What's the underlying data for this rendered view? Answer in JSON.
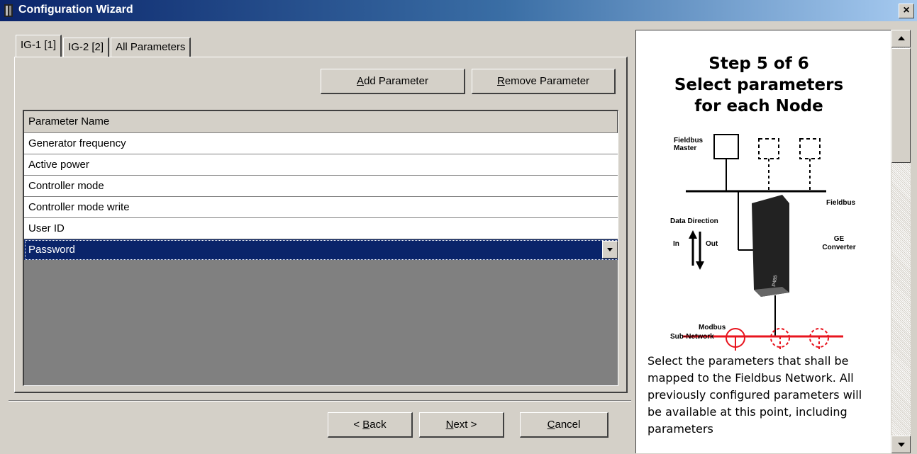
{
  "window": {
    "title": "Configuration Wizard",
    "close_glyph": "×"
  },
  "tabs": [
    {
      "label": "IG-1 [1]",
      "active": true
    },
    {
      "label": "IG-2 [2]",
      "active": false
    },
    {
      "label": "All Parameters",
      "active": false
    }
  ],
  "toolbar": {
    "add_label_accel": "A",
    "add_label_rest": "dd Parameter",
    "remove_label_accel": "R",
    "remove_label_rest": "emove Parameter"
  },
  "grid": {
    "header": "Parameter Name",
    "rows": [
      "Generator frequency",
      "Active power",
      "Controller mode",
      "Controller mode write",
      "User ID",
      "Password"
    ],
    "selected_index": 5
  },
  "nav": {
    "back_prefix": "< ",
    "back_accel": "B",
    "back_rest": "ack",
    "next_accel": "N",
    "next_rest": "ext >",
    "cancel_accel": "C",
    "cancel_rest": "ancel"
  },
  "help": {
    "step_line1": "Step 5 of 6",
    "step_line2": "Select parameters",
    "step_line3": "for each Node",
    "diagram": {
      "fieldbus_master_line1": "Fieldbus",
      "fieldbus_master_line2": "Master",
      "fieldbus": "Fieldbus",
      "data_direction": "Data Direction",
      "in": "In",
      "out": "Out",
      "ge_line1": "GE",
      "ge_line2": "Converter",
      "device_label": "P485",
      "modbus_line1": "Modbus",
      "modbus_line2": "Sub-Network"
    },
    "description": "Select the parameters that shall be mapped to the Fieldbus Network. All previously configured parameters will be available at this point, including parameters"
  },
  "colors": {
    "selection": "#0a246a",
    "modbus": "#e8141e",
    "face": "#d4d0c8"
  }
}
